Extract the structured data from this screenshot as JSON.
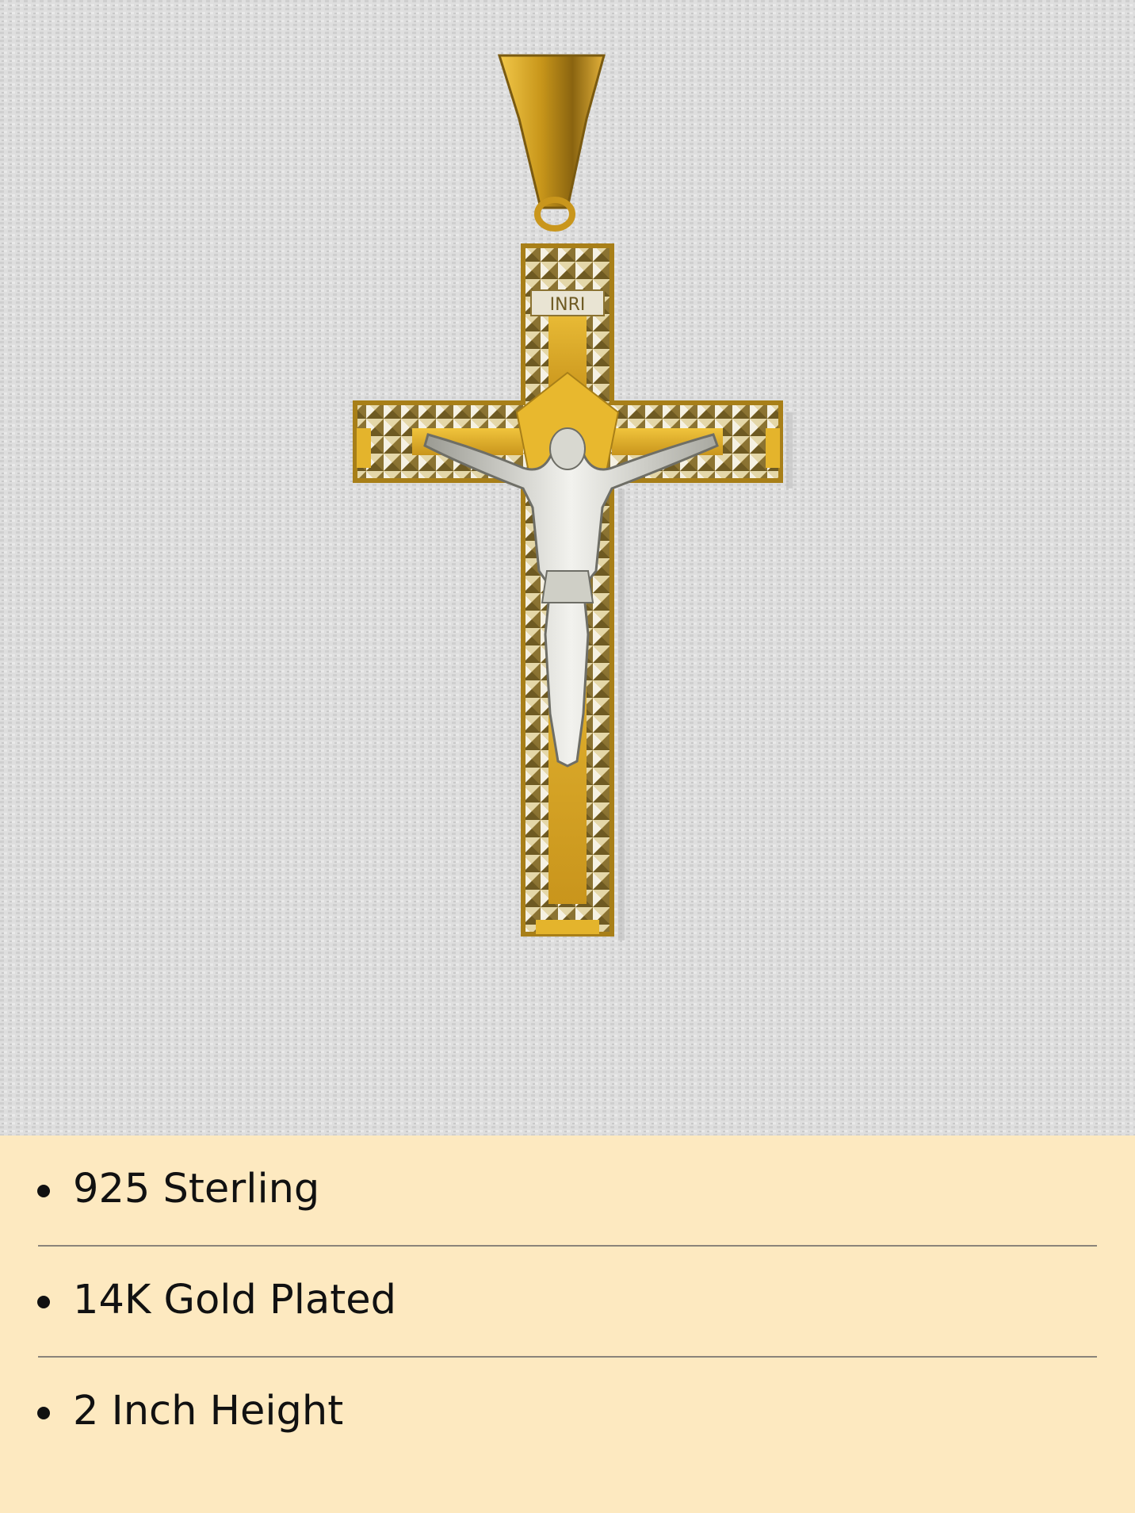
{
  "product_photo": {
    "background_color": "#dcdcdc",
    "gold_color": "#d4a520",
    "silver_color": "#e6e6e6",
    "inscription": "INRI"
  },
  "specs": {
    "items": [
      {
        "label": "925 Sterling"
      },
      {
        "label": "14K Gold Plated"
      },
      {
        "label": "2 Inch Height"
      }
    ]
  },
  "colors": {
    "panel_background": "#fde9c0",
    "text": "#111111",
    "divider": "#8a847a"
  }
}
